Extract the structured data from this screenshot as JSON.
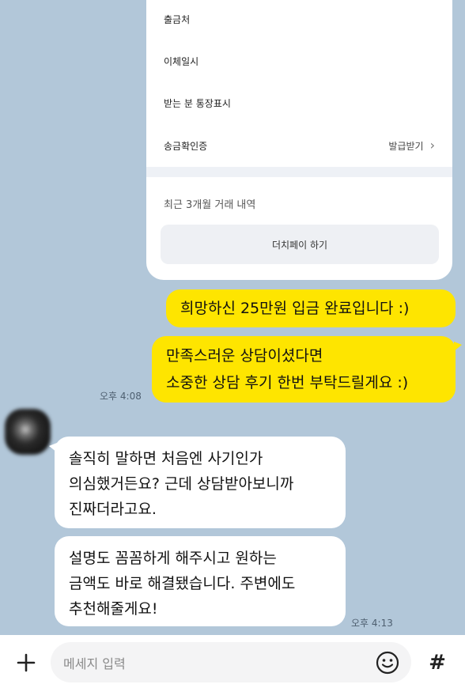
{
  "transfer_card": {
    "rows": [
      {
        "label": "출금처",
        "value": ""
      },
      {
        "label": "이체일시",
        "value": ""
      },
      {
        "label": "받는 분 통장표시",
        "value": ""
      },
      {
        "label": "송금확인증",
        "value": "발급받기"
      }
    ],
    "recent_label": "최근 3개월 거래 내역",
    "button_label": "더치페이 하기"
  },
  "messages": {
    "me_1": "희망하신 25만원 입금 완료입니다 :)",
    "me_2_line1": "만족스러운 상담이셨다면",
    "me_2_line2": "소중한 상담 후기 한번 부탁드릴게요 :)",
    "time_1": "오후 4:08",
    "other_1_line1": "솔직히 말하면 처음엔 사기인가",
    "other_1_line2": "의심했거든요? 근데 상담받아보니까",
    "other_1_line3": "진짜더라고요.",
    "other_2_line1": "설명도 꼼꼼하게 해주시고 원하는",
    "other_2_line2": "금액도 바로 해결됐습니다. 주변에도",
    "other_2_line3": "추천해줄게요!",
    "time_2": "오후 4:13"
  },
  "input": {
    "placeholder": "메세지 입력",
    "plus_icon": "plus-icon",
    "emoji_icon": "emoji-icon",
    "hash_symbol": "#"
  }
}
